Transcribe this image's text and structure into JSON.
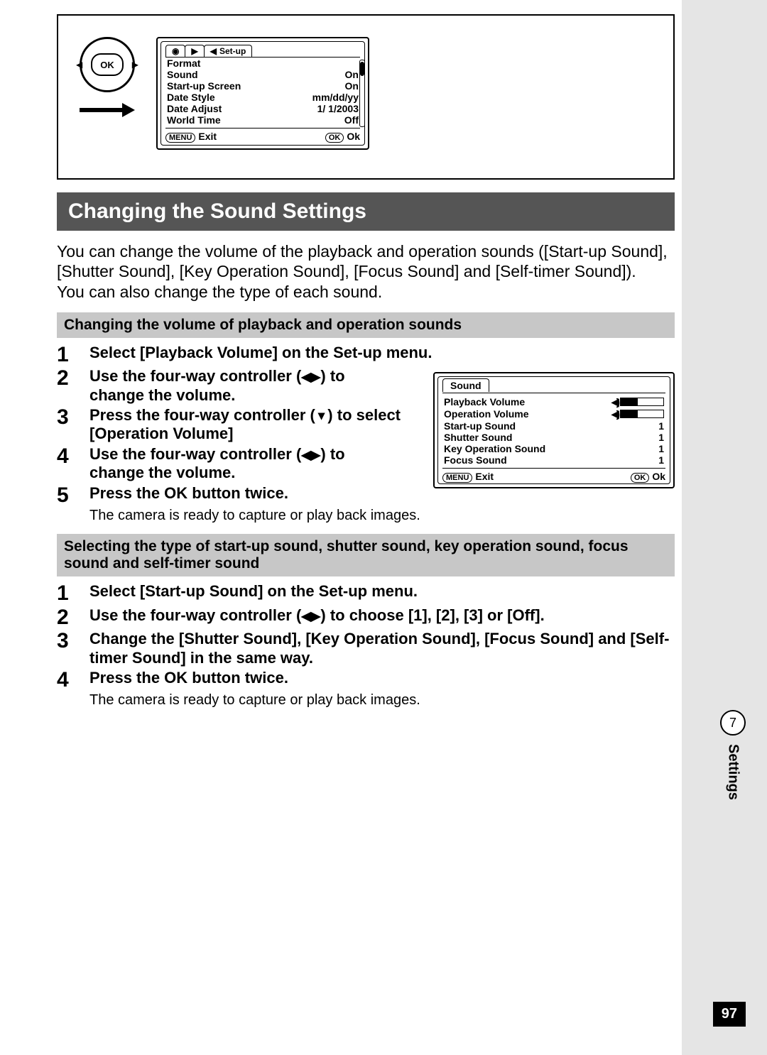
{
  "illustration": {
    "ok": "OK",
    "setup_tab": "Set-up",
    "rows": [
      {
        "label": "Format",
        "value": ""
      },
      {
        "label": "Sound",
        "value": "On"
      },
      {
        "label": "Start-up Screen",
        "value": "On"
      },
      {
        "label": "Date Style",
        "value": "mm/dd/yy"
      },
      {
        "label": "Date Adjust",
        "value": "1/ 1/2003"
      },
      {
        "label": "World Time",
        "value": "Off"
      }
    ],
    "footer": {
      "menu_btn": "MENU",
      "exit": "Exit",
      "ok_btn": "OK",
      "ok": "Ok"
    }
  },
  "section_title": "Changing the Sound Settings",
  "intro": [
    "You can change the volume of the playback and operation sounds ([Start-up Sound], [Shutter Sound], [Key Operation Sound], [Focus Sound] and [Self-timer Sound]).",
    "You can also change the type of each sound."
  ],
  "sub1": "Changing the volume of playback and operation sounds",
  "steps1": [
    {
      "num": "1",
      "text": "Select [Playback Volume] on the Set-up menu."
    },
    {
      "num": "2",
      "a": "Use the four-way controller",
      "b": "to change the volume."
    },
    {
      "num": "3",
      "a": "Press the four-way controller",
      "b": "to select [Operation Volume]"
    },
    {
      "num": "4",
      "a": "Use the four-way controller",
      "b": "to change the volume."
    },
    {
      "num": "5",
      "text": "Press the OK button twice."
    }
  ],
  "note1": "The camera is ready to capture or play back images.",
  "sound_lcd": {
    "tab": "Sound",
    "rows": [
      {
        "label": "Playback Volume"
      },
      {
        "label": "Operation Volume"
      },
      {
        "label": "Start-up Sound",
        "value": "1"
      },
      {
        "label": "Shutter Sound",
        "value": "1"
      },
      {
        "label": "Key Operation Sound",
        "value": "1"
      },
      {
        "label": "Focus Sound",
        "value": "1"
      }
    ],
    "footer": {
      "menu_btn": "MENU",
      "exit": "Exit",
      "ok_btn": "OK",
      "ok": "Ok"
    }
  },
  "sub2": "Selecting the type of start-up sound, shutter sound, key operation sound, focus sound and self-timer sound",
  "steps2": [
    {
      "num": "1",
      "text": "Select [Start-up Sound] on the Set-up menu."
    },
    {
      "num": "2",
      "a": "Use the four-way controller",
      "b": "to choose [1], [2], [3] or [Off]."
    },
    {
      "num": "3",
      "text": "Change the [Shutter Sound], [Key Operation Sound], [Focus Sound] and [Self-timer Sound] in the same way."
    },
    {
      "num": "4",
      "text": "Press the OK button twice."
    }
  ],
  "note2": "The camera is ready to capture or play back images.",
  "side": {
    "num": "7",
    "label": "Settings"
  },
  "page_number": "97"
}
